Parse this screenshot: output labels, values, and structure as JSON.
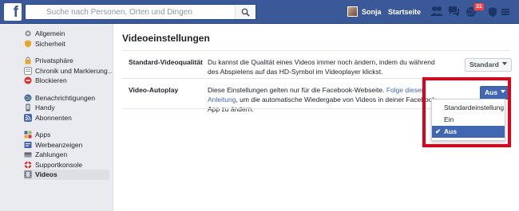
{
  "topbar": {
    "logo": "f",
    "search_placeholder": "Suche nach Personen, Orten und Dingen",
    "user_name": "Sonja",
    "home_label": "Startseite",
    "notification_count": "31",
    "brand_color": "#3b5998"
  },
  "sidebar": {
    "groups": [
      [
        {
          "label": "Allgemein",
          "icon": "gear-icon"
        },
        {
          "label": "Sicherheit",
          "icon": "shield-icon"
        }
      ],
      [
        {
          "label": "Privatsphäre",
          "icon": "lock-icon"
        },
        {
          "label": "Chronik und Markierung…",
          "icon": "timeline-icon"
        },
        {
          "label": "Blockieren",
          "icon": "block-icon"
        }
      ],
      [
        {
          "label": "Benachrichtigungen",
          "icon": "globe-icon"
        },
        {
          "label": "Handy",
          "icon": "phone-icon"
        },
        {
          "label": "Abonnenten",
          "icon": "rss-icon"
        }
      ],
      [
        {
          "label": "Apps",
          "icon": "apps-icon"
        },
        {
          "label": "Werbeanzeigen",
          "icon": "ads-icon"
        },
        {
          "label": "Zahlungen",
          "icon": "card-icon"
        },
        {
          "label": "Supportkonsole",
          "icon": "lifebuoy-icon"
        },
        {
          "label": "Videos",
          "icon": "film-icon",
          "active": true
        }
      ]
    ]
  },
  "main": {
    "title": "Videoeinstellungen",
    "quality": {
      "label": "Standard-Videoqualität",
      "description": "Du kannst die Qualität eines Videos immer noch ändern, indem du während des Abspielens auf das HD-Symbol im Videoplayer klickst.",
      "button": "Standard"
    },
    "autoplay": {
      "label": "Video-Autoplay",
      "description_before": "Diese Einstellungen gelten nur für die Facebook-Webseite. ",
      "link": "Folge dieser Anleitung",
      "description_after": ", um die automatische Wiedergabe von Videos in deiner Facebook-App zu ändern.",
      "button": "Aus",
      "options": [
        "Standardeinstellung",
        "Ein",
        "Aus"
      ],
      "selected": "Aus"
    },
    "highlight_color": "#e1001a"
  }
}
